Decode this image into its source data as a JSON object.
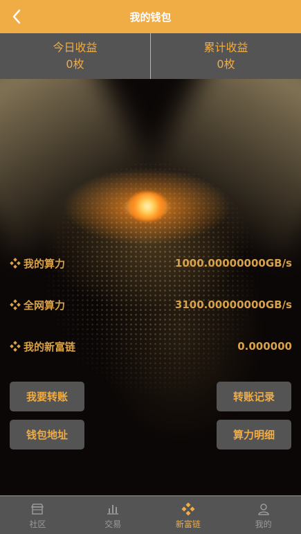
{
  "header": {
    "title": "我的钱包",
    "back_icon": "chevron-left-icon"
  },
  "stats": [
    {
      "label": "今日收益",
      "value": "0枚"
    },
    {
      "label": "累计收益",
      "value": "0枚"
    }
  ],
  "info_rows": [
    {
      "icon": "diamond-icon",
      "label": "我的算力",
      "value": "1000.00000000GB/s"
    },
    {
      "icon": "diamond-icon",
      "label": "全网算力",
      "value": "3100.00000000GB/s"
    },
    {
      "icon": "diamond-icon",
      "label": "我的新富链",
      "value": "0.000000"
    }
  ],
  "buttons": {
    "transfer": "我要转账",
    "transfer_records": "转账记录",
    "wallet_address": "钱包地址",
    "hashrate_details": "算力明细"
  },
  "tabbar": {
    "items": [
      {
        "label": "社区",
        "icon": "store-icon"
      },
      {
        "label": "交易",
        "icon": "bar-chart-icon"
      },
      {
        "label": "新富链",
        "icon": "diamond-grid-icon",
        "active": true
      },
      {
        "label": "我的",
        "icon": "user-icon"
      }
    ]
  },
  "colors": {
    "accent": "#f0ac45",
    "panel": "#545454",
    "background": "#0b0706",
    "text_gold": "#d8a24a"
  }
}
